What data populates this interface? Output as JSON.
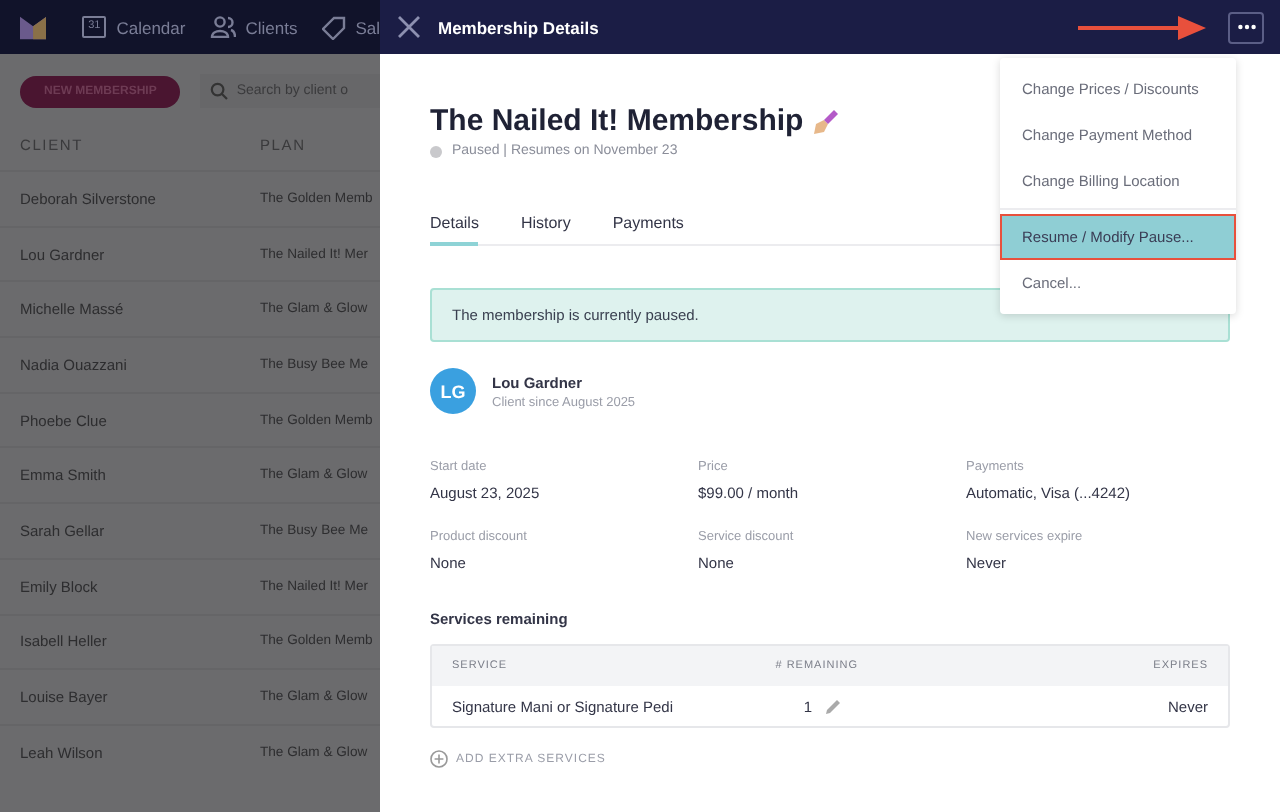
{
  "nav": {
    "items": [
      {
        "kind": "calendar",
        "label": "Calendar",
        "icon_text": "31"
      },
      {
        "kind": "clients",
        "label": "Clients"
      },
      {
        "kind": "tag",
        "label": "Sal"
      }
    ]
  },
  "page": {
    "new_button": "NEW MEMBERSHIP",
    "search_placeholder": "Search by client o",
    "columns": [
      "CLIENT",
      "PLAN"
    ],
    "rows": [
      {
        "client": "Deborah Silverstone",
        "plan": "The Golden Memb"
      },
      {
        "client": "Lou Gardner",
        "plan": "The Nailed It! Mer"
      },
      {
        "client": "Michelle Massé",
        "plan": "The Glam & Glow"
      },
      {
        "client": "Nadia Ouazzani",
        "plan": "The Busy Bee Me"
      },
      {
        "client": "Phoebe Clue",
        "plan": "The Golden Memb"
      },
      {
        "client": "Emma Smith",
        "plan": "The Glam & Glow"
      },
      {
        "client": "Sarah Gellar",
        "plan": "The Busy Bee Me"
      },
      {
        "client": "Emily Block",
        "plan": "The Nailed It! Mer"
      },
      {
        "client": "Isabell Heller",
        "plan": "The Golden Memb"
      },
      {
        "client": "Louise Bayer",
        "plan": "The Glam & Glow"
      },
      {
        "client": "Leah Wilson",
        "plan": "The Glam & Glow"
      }
    ]
  },
  "drawer": {
    "title": "Membership Details",
    "name": "The Nailed It! Membership",
    "status": "Paused | Resumes on November 23",
    "tabs": [
      {
        "label": "Details",
        "selected": true
      },
      {
        "label": "History",
        "selected": false
      },
      {
        "label": "Payments",
        "selected": false
      }
    ],
    "alert": "The membership is currently paused.",
    "client": {
      "initials": "LG",
      "name": "Lou Gardner",
      "since": "Client since August 2025"
    },
    "fields": [
      {
        "label": "Start date",
        "value": "August 23, 2025"
      },
      {
        "label": "Price",
        "value": "$99.00 / month"
      },
      {
        "label": "Payments",
        "value": "Automatic, Visa (...4242)"
      },
      {
        "label": "Product discount",
        "value": "None"
      },
      {
        "label": "Service discount",
        "value": "None"
      },
      {
        "label": "New services expire",
        "value": "Never"
      }
    ],
    "services": {
      "heading": "Services remaining",
      "columns": [
        "SERVICE",
        "# REMAINING",
        "EXPIRES"
      ],
      "rows": [
        {
          "service": "Signature Mani or Signature Pedi",
          "remaining": "1",
          "expires": "Never"
        }
      ],
      "add_label": "ADD EXTRA SERVICES"
    }
  },
  "menu": {
    "items": [
      {
        "label": "Change Prices / Discounts",
        "selected": false
      },
      {
        "label": "Change Payment Method",
        "selected": false
      },
      {
        "label": "Change Billing Location",
        "selected": false
      },
      {
        "label": "Resume / Modify Pause...",
        "selected": true
      },
      {
        "label": "Cancel...",
        "selected": false
      }
    ]
  }
}
